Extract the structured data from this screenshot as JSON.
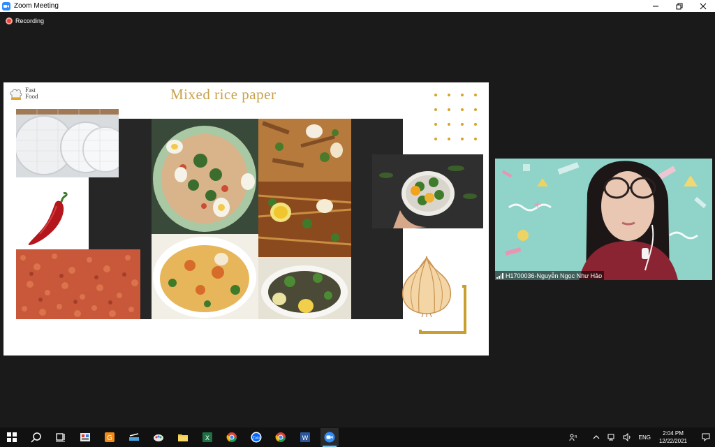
{
  "window": {
    "title": "Zoom Meeting"
  },
  "recording": {
    "label": "Recording"
  },
  "slide": {
    "logo_line1": "Fast",
    "logo_line2": "Food",
    "title": "Mixed rice paper"
  },
  "video": {
    "participant_name": "H1700036-Nguyễn Ngọc Như Hảo"
  },
  "taskbar": {
    "apps": [
      "start-icon",
      "search-icon",
      "task-view-icon",
      "app-icon",
      "app-icon",
      "scanner-icon",
      "paint-icon",
      "file-explorer-icon",
      "excel-icon",
      "chrome-icon",
      "zalo-icon",
      "chrome-icon",
      "word-icon",
      "zoom-icon"
    ],
    "zalo_label": "Zalo",
    "language": "ENG",
    "time": "2:04 PM",
    "date": "12/22/2021"
  },
  "colors": {
    "slide_title": "#c8a04a",
    "accent_gold": "#d6a42a",
    "zoom_blue": "#2d8cff",
    "recording_red": "#e8463c"
  }
}
